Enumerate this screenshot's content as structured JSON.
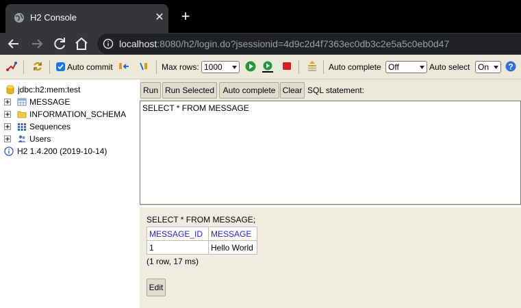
{
  "browser": {
    "tab_title": "H2 Console",
    "tab_close": "✕",
    "new_tab": "+",
    "url_host": "localhost",
    "url_rest": ":8080/h2/login.do?jsessionid=4d9c2d4f7363ec0db3c2e5a5c0eb0d47"
  },
  "toolbar": {
    "auto_commit_label": "Auto commit",
    "auto_commit_checked": true,
    "max_rows_label": "Max rows:",
    "max_rows_value": "1000",
    "auto_complete_label": "Auto complete",
    "auto_complete_value": "Off",
    "auto_select_label": "Auto select",
    "auto_select_value": "On",
    "icons": [
      "disconnect-icon",
      "refresh-icon",
      "rollback-icon",
      "commit-icon",
      "run-icon",
      "run-selected-icon",
      "stop-icon",
      "history-icon",
      "help-icon"
    ]
  },
  "tree": {
    "root": "jdbc:h2:mem:test",
    "items": [
      {
        "label": "MESSAGE",
        "icon": "table-icon"
      },
      {
        "label": "INFORMATION_SCHEMA",
        "icon": "folder-icon"
      },
      {
        "label": "Sequences",
        "icon": "sequence-icon"
      },
      {
        "label": "Users",
        "icon": "users-icon"
      }
    ],
    "version": "H2 1.4.200 (2019-10-14)"
  },
  "query": {
    "buttons": {
      "run": "Run",
      "run_selected": "Run Selected",
      "auto_complete": "Auto complete",
      "clear": "Clear"
    },
    "sql_label": "SQL statement:",
    "sql_text": "SELECT * FROM MESSAGE"
  },
  "result": {
    "statement": "SELECT * FROM MESSAGE;",
    "columns": [
      "MESSAGE_ID",
      "MESSAGE"
    ],
    "rows": [
      [
        "1",
        "Hello World"
      ]
    ],
    "meta": "(1 row, 17 ms)",
    "edit_label": "Edit"
  },
  "colors": {
    "panel_bg": "#ece9d8",
    "header_text": "#2424c8",
    "browser_bg": "#35363a"
  }
}
